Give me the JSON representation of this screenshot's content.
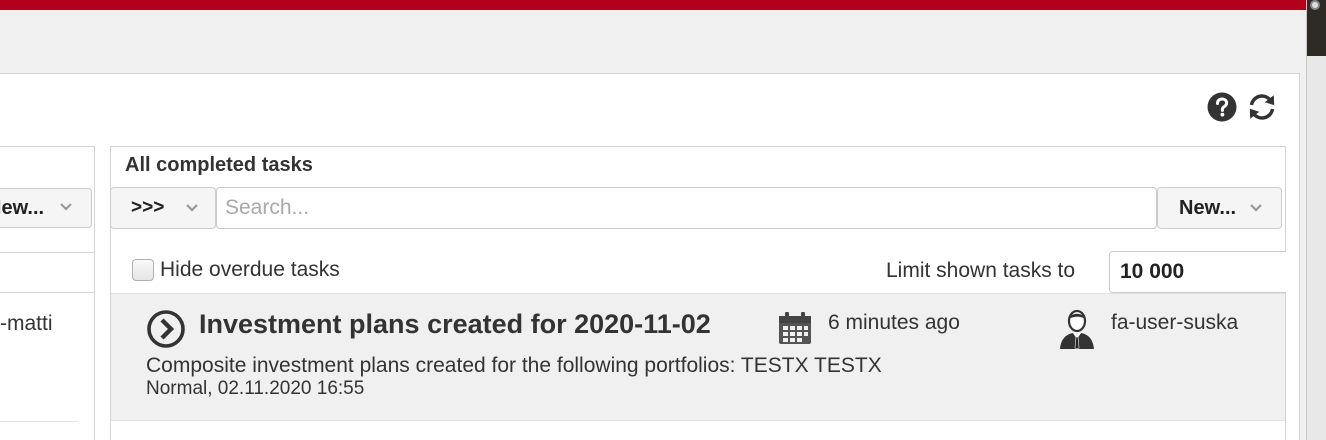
{
  "left_panel": {
    "new_button_label": "New...",
    "row_text": "-matti"
  },
  "tasks_panel": {
    "title": "All completed tasks",
    "filter_button_label": ">>>",
    "search_placeholder": "Search...",
    "new_button_label": "New...",
    "hide_overdue_label": "Hide overdue tasks",
    "hide_overdue_checked": false,
    "limit_label": "Limit shown tasks to",
    "limit_value": "10 000"
  },
  "tasks": [
    {
      "title": "Investment plans created for 2020-11-02",
      "time": "6 minutes ago",
      "user": "fa-user-suska",
      "description": "Composite investment plans created for the following portfolios: TESTX TESTX",
      "meta": "Normal, 02.11.2020 16:55",
      "icons": {
        "open": "chevron-right-circle-icon",
        "time": "calendar-icon",
        "user": "user-avatar-icon"
      }
    }
  ],
  "toolbar_icons": [
    "help-icon",
    "refresh-icon"
  ],
  "colors": {
    "accent_bar": "#b3001b",
    "text": "#333333",
    "task_row_bg": "#f0f0f0"
  }
}
